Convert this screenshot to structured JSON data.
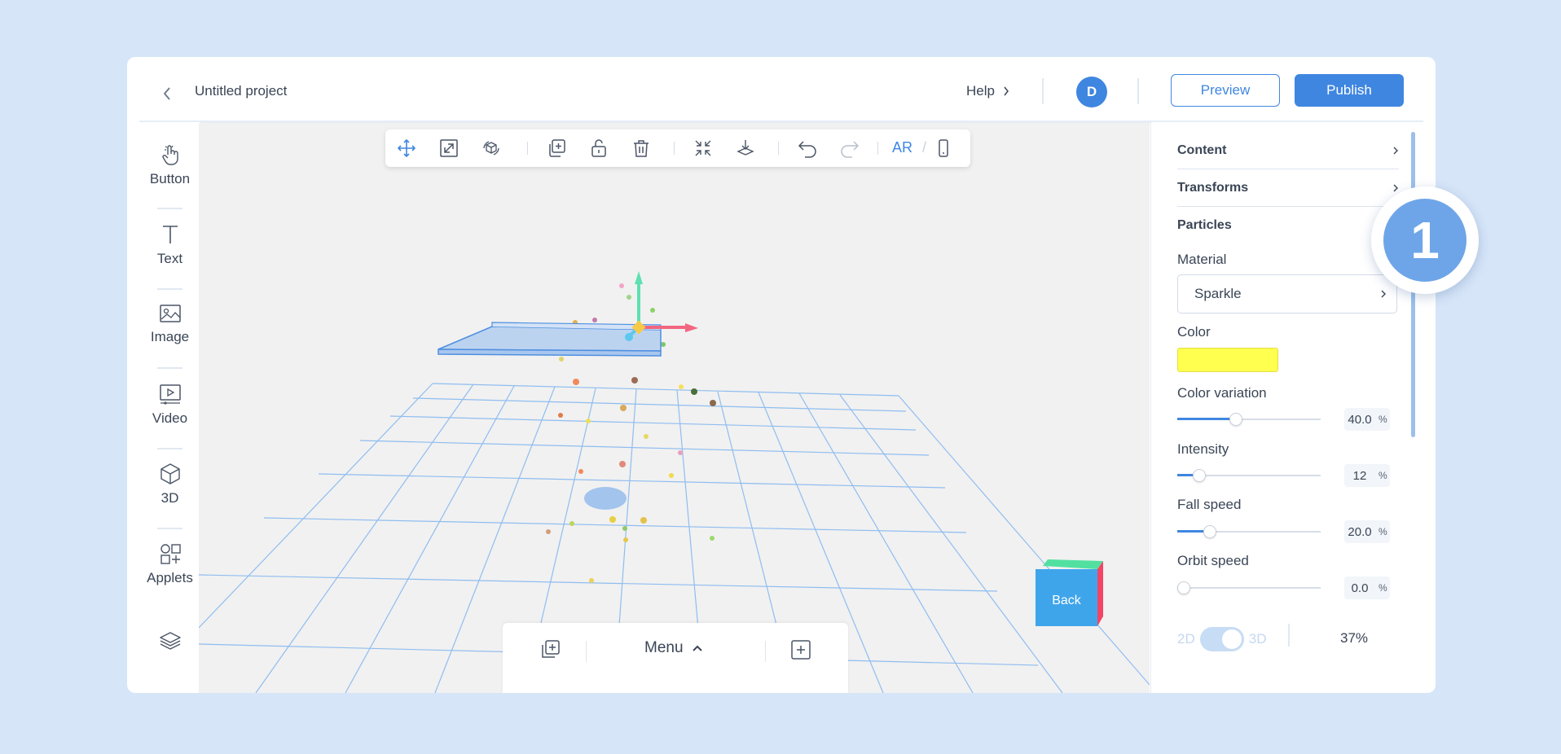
{
  "header": {
    "project_title": "Untitled project",
    "help_label": "Help",
    "avatar_initial": "D",
    "preview_label": "Preview",
    "publish_label": "Publish"
  },
  "left_tools": [
    {
      "label": "Button",
      "icon": "hand-pointer-icon"
    },
    {
      "label": "Text",
      "icon": "text-icon"
    },
    {
      "label": "Image",
      "icon": "image-icon"
    },
    {
      "label": "Video",
      "icon": "video-icon"
    },
    {
      "label": "3D",
      "icon": "cube-icon"
    },
    {
      "label": "Applets",
      "icon": "applets-icon"
    },
    {
      "label": "",
      "icon": "layers-icon"
    }
  ],
  "viewport_toolbar": {
    "ar_label": "AR",
    "ar_separator": "/",
    "icons": [
      "move-icon",
      "scale-icon",
      "rotate-icon",
      "duplicate-icon",
      "unlock-icon",
      "trash-icon",
      "collapse-icon",
      "drop-to-floor-icon",
      "undo-icon",
      "redo-icon",
      "mobile-icon"
    ]
  },
  "bottom_bar": {
    "menu_label": "Menu"
  },
  "cube_nav": {
    "front_label": "Back"
  },
  "panel": {
    "sections": [
      {
        "label": "Content"
      },
      {
        "label": "Transforms"
      },
      {
        "label": "Particles"
      }
    ],
    "material_label": "Material",
    "material_value": "Sparkle",
    "color_label": "Color",
    "color_value": "#ffff4f",
    "sliders": [
      {
        "label": "Color variation",
        "value": "40.0",
        "unit": "%",
        "fraction": 0.4
      },
      {
        "label": "Intensity",
        "value": "12",
        "unit": "%",
        "fraction": 0.12
      },
      {
        "label": "Fall speed",
        "value": "20.0",
        "unit": "%",
        "fraction": 0.2
      },
      {
        "label": "Orbit speed",
        "value": "0.0",
        "unit": "%",
        "fraction": 0.0
      }
    ],
    "toggle_2d": "2D",
    "toggle_3d": "3D",
    "zoom": "37%"
  },
  "badge": {
    "number": "1"
  },
  "colors": {
    "accent": "#3f86e0",
    "background": "#d6e5f8",
    "grid": "#8fbdf0"
  }
}
